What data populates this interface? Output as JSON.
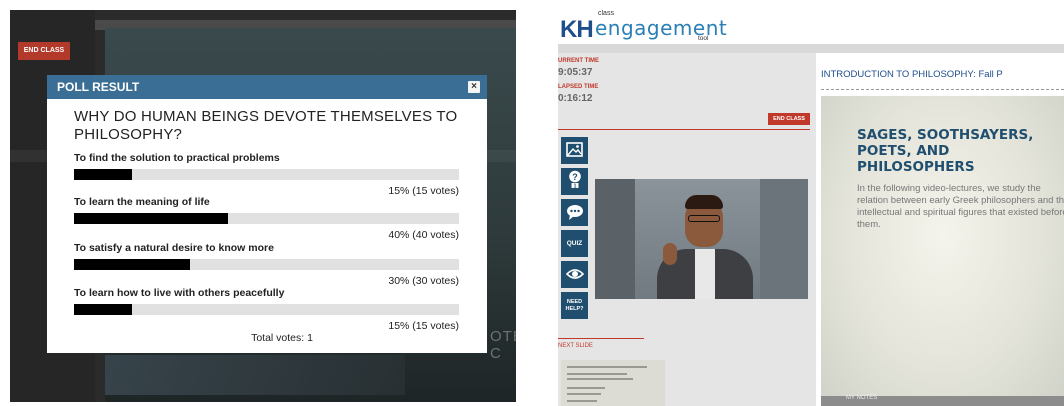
{
  "left": {
    "end_class_label": "END CLASS",
    "background_fragment_text": "OTE C",
    "poll": {
      "header": "POLL RESULT",
      "close_symbol": "×",
      "question": "WHY DO HUMAN BEINGS DEVOTE THEMSELVES TO PHILOSOPHY?",
      "options": [
        {
          "label": "To find the solution to practical problems",
          "percent_fraction": 0.15,
          "result": "15% (15 votes)"
        },
        {
          "label": "To learn the meaning of life",
          "percent_fraction": 0.4,
          "result": "40% (40 votes)"
        },
        {
          "label": "To satisfy a natural desire to know more",
          "percent_fraction": 0.3,
          "result": "30% (30 votes)"
        },
        {
          "label": "To learn how to live with others peacefully",
          "percent_fraction": 0.15,
          "result": "15% (15 votes)"
        }
      ],
      "total": "Total votes: 1"
    }
  },
  "right": {
    "logo": {
      "kh": "KH",
      "class": "class",
      "engagement": "engagement",
      "tool": "tool"
    },
    "current_time_label": "URRENT TIME",
    "current_time": "9:05:37",
    "elapsed_time_label": "LAPSED TIME",
    "elapsed_time": "0:16:12",
    "end_class_label": "END CLASS",
    "tools": {
      "quiz": "QUIZ",
      "help_line1": "NEED",
      "help_line2": "HELP?",
      "question_badge": "1"
    },
    "next_slide_label": "NEXT SLIDE",
    "main_title": "INTRODUCTION TO PHILOSOPHY:",
    "main_title_suffix": "Fall P",
    "slide": {
      "title": "SAGES, SOOTHSAYERS, POETS, AND PHILOSOPHERS",
      "body": "In the following video-lectures, we study the relation between early Greek philosophers and the intellectual and spiritual figures that existed before them."
    },
    "footer_text": "MY NOTES"
  },
  "colors": {
    "poll_header": "#3b6e94",
    "end_class": "#b33a2a",
    "brand_blue": "#1f4e8c",
    "tool_button": "#1f4e6e"
  }
}
